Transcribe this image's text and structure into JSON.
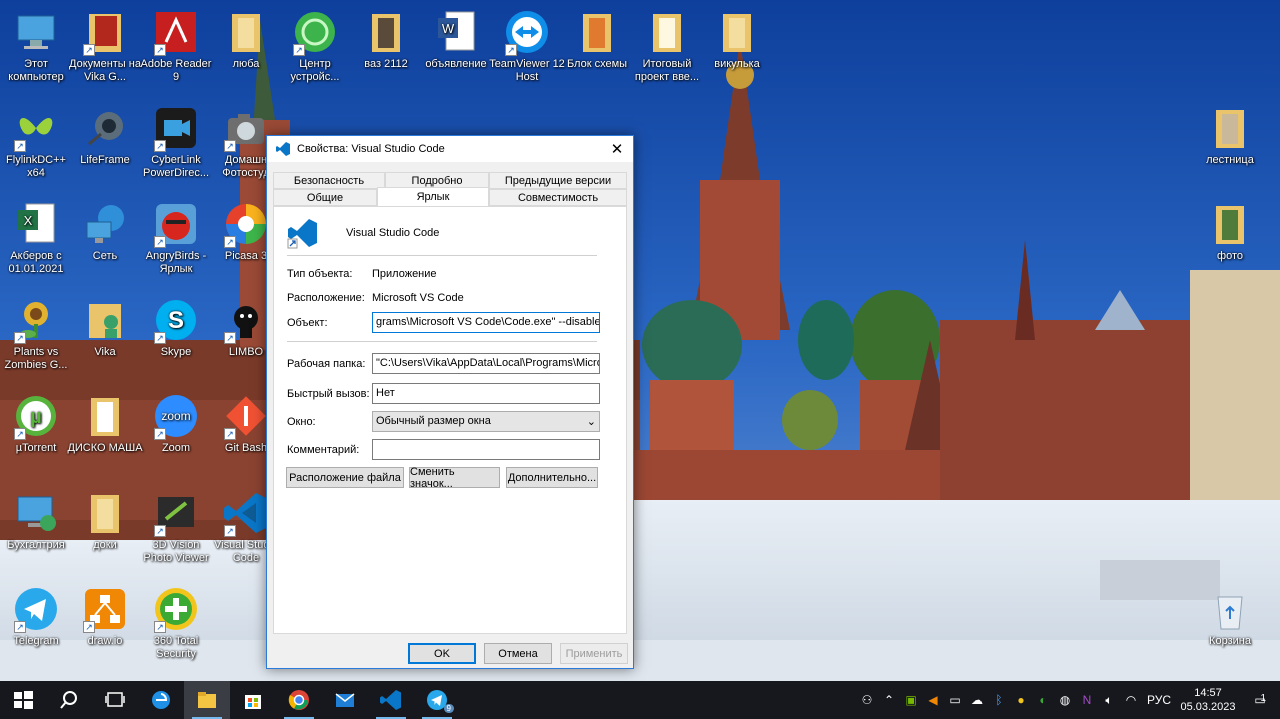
{
  "desktop": {
    "icons": [
      {
        "label": "Этот компьютер",
        "icon": "computer-icon"
      },
      {
        "label": "Документы на Vika G...",
        "icon": "folder-icon"
      },
      {
        "label": "Adobe Reader 9",
        "icon": "pdf-icon"
      },
      {
        "label": "люба",
        "icon": "folder-icon"
      },
      {
        "label": "Центр устройс...",
        "icon": "device-center-icon"
      },
      {
        "label": "ваз 2112",
        "icon": "folder-icon"
      },
      {
        "label": "объявление",
        "icon": "word-icon"
      },
      {
        "label": "TeamViewer 12 Host",
        "icon": "teamviewer-icon"
      },
      {
        "label": "Блок схемы",
        "icon": "folder-icon"
      },
      {
        "label": "Итоговый проект вве...",
        "icon": "folder-icon"
      },
      {
        "label": "викулька",
        "icon": "folder-icon"
      },
      {
        "label": "FlylinkDC++ x64",
        "icon": "butterfly-icon"
      },
      {
        "label": "LifeFrame",
        "icon": "webcam-icon"
      },
      {
        "label": "CyberLink PowerDirec...",
        "icon": "video-editor-icon"
      },
      {
        "label": "Домашн Фотостуд",
        "icon": "camera-icon"
      },
      {
        "label": "лестница",
        "icon": "folder-icon"
      },
      {
        "label": "Акберов с 01.01.2021",
        "icon": "excel-icon"
      },
      {
        "label": "Сеть",
        "icon": "network-icon"
      },
      {
        "label": "AngryBirds - Ярлык",
        "icon": "angry-birds-icon"
      },
      {
        "label": "Picasa 3",
        "icon": "picasa-icon"
      },
      {
        "label": "фото",
        "icon": "folder-icon"
      },
      {
        "label": "Plants vs Zombies G...",
        "icon": "plant-icon"
      },
      {
        "label": "Vika",
        "icon": "user-folder-icon"
      },
      {
        "label": "Skype",
        "icon": "skype-icon"
      },
      {
        "label": "LIMBO",
        "icon": "limbo-icon"
      },
      {
        "label": "µTorrent",
        "icon": "utorrent-icon"
      },
      {
        "label": "ДИСКО МАША",
        "icon": "folder-icon"
      },
      {
        "label": "Zoom",
        "icon": "zoom-icon"
      },
      {
        "label": "Git Bash",
        "icon": "git-icon"
      },
      {
        "label": "Бухгалтрия",
        "icon": "accounting-icon"
      },
      {
        "label": "доки",
        "icon": "folder-icon"
      },
      {
        "label": "3D Vision Photo Viewer",
        "icon": "3d-vision-icon"
      },
      {
        "label": "Visual Studio Code",
        "icon": "vscode-icon"
      },
      {
        "label": "Telegram",
        "icon": "telegram-icon"
      },
      {
        "label": "draw.io",
        "icon": "drawio-icon"
      },
      {
        "label": "360 Total Security",
        "icon": "360-security-icon"
      },
      {
        "label": "Корзина",
        "icon": "recycle-bin-icon"
      }
    ]
  },
  "dialog": {
    "title": "Свойства: Visual Studio Code",
    "tabs_row1": [
      "Безопасность",
      "Подробно",
      "Предыдущие версии"
    ],
    "tabs_row2": [
      "Общие",
      "Ярлык",
      "Совместимость"
    ],
    "app_name": "Visual Studio Code",
    "type_label": "Тип объекта:",
    "type_value": "Приложение",
    "location_label": "Расположение:",
    "location_value": "Microsoft VS Code",
    "target_label": "Объект:",
    "target_value": "grams\\Microsoft VS Code\\Code.exe\" --disable-gpu",
    "workdir_label": "Рабочая папка:",
    "workdir_value": "\"C:\\Users\\Vika\\AppData\\Local\\Programs\\Microso",
    "hotkey_label": "Быстрый вызов:",
    "hotkey_value": "Нет",
    "window_label": "Окно:",
    "window_value": "Обычный размер окна",
    "comment_label": "Комментарий:",
    "comment_value": "",
    "btn_file_location": "Расположение файла",
    "btn_change_icon": "Сменить значок...",
    "btn_advanced": "Дополнительно...",
    "btn_ok": "OK",
    "btn_cancel": "Отмена",
    "btn_apply": "Применить"
  },
  "taskbar": {
    "items": [
      "start-icon",
      "search-icon",
      "task-view-icon",
      "edge-icon",
      "explorer-icon",
      "store-icon",
      "chrome-icon",
      "mail-icon",
      "vscode-icon",
      "telegram-icon"
    ],
    "telegram_badge": "9",
    "language": "РУС",
    "time": "14:57",
    "date": "05.03.2023",
    "notification_count": "1"
  },
  "colors": {
    "accent": "#0078d7",
    "taskbar": "#16181d",
    "dialog_border": "#2b79d8"
  }
}
